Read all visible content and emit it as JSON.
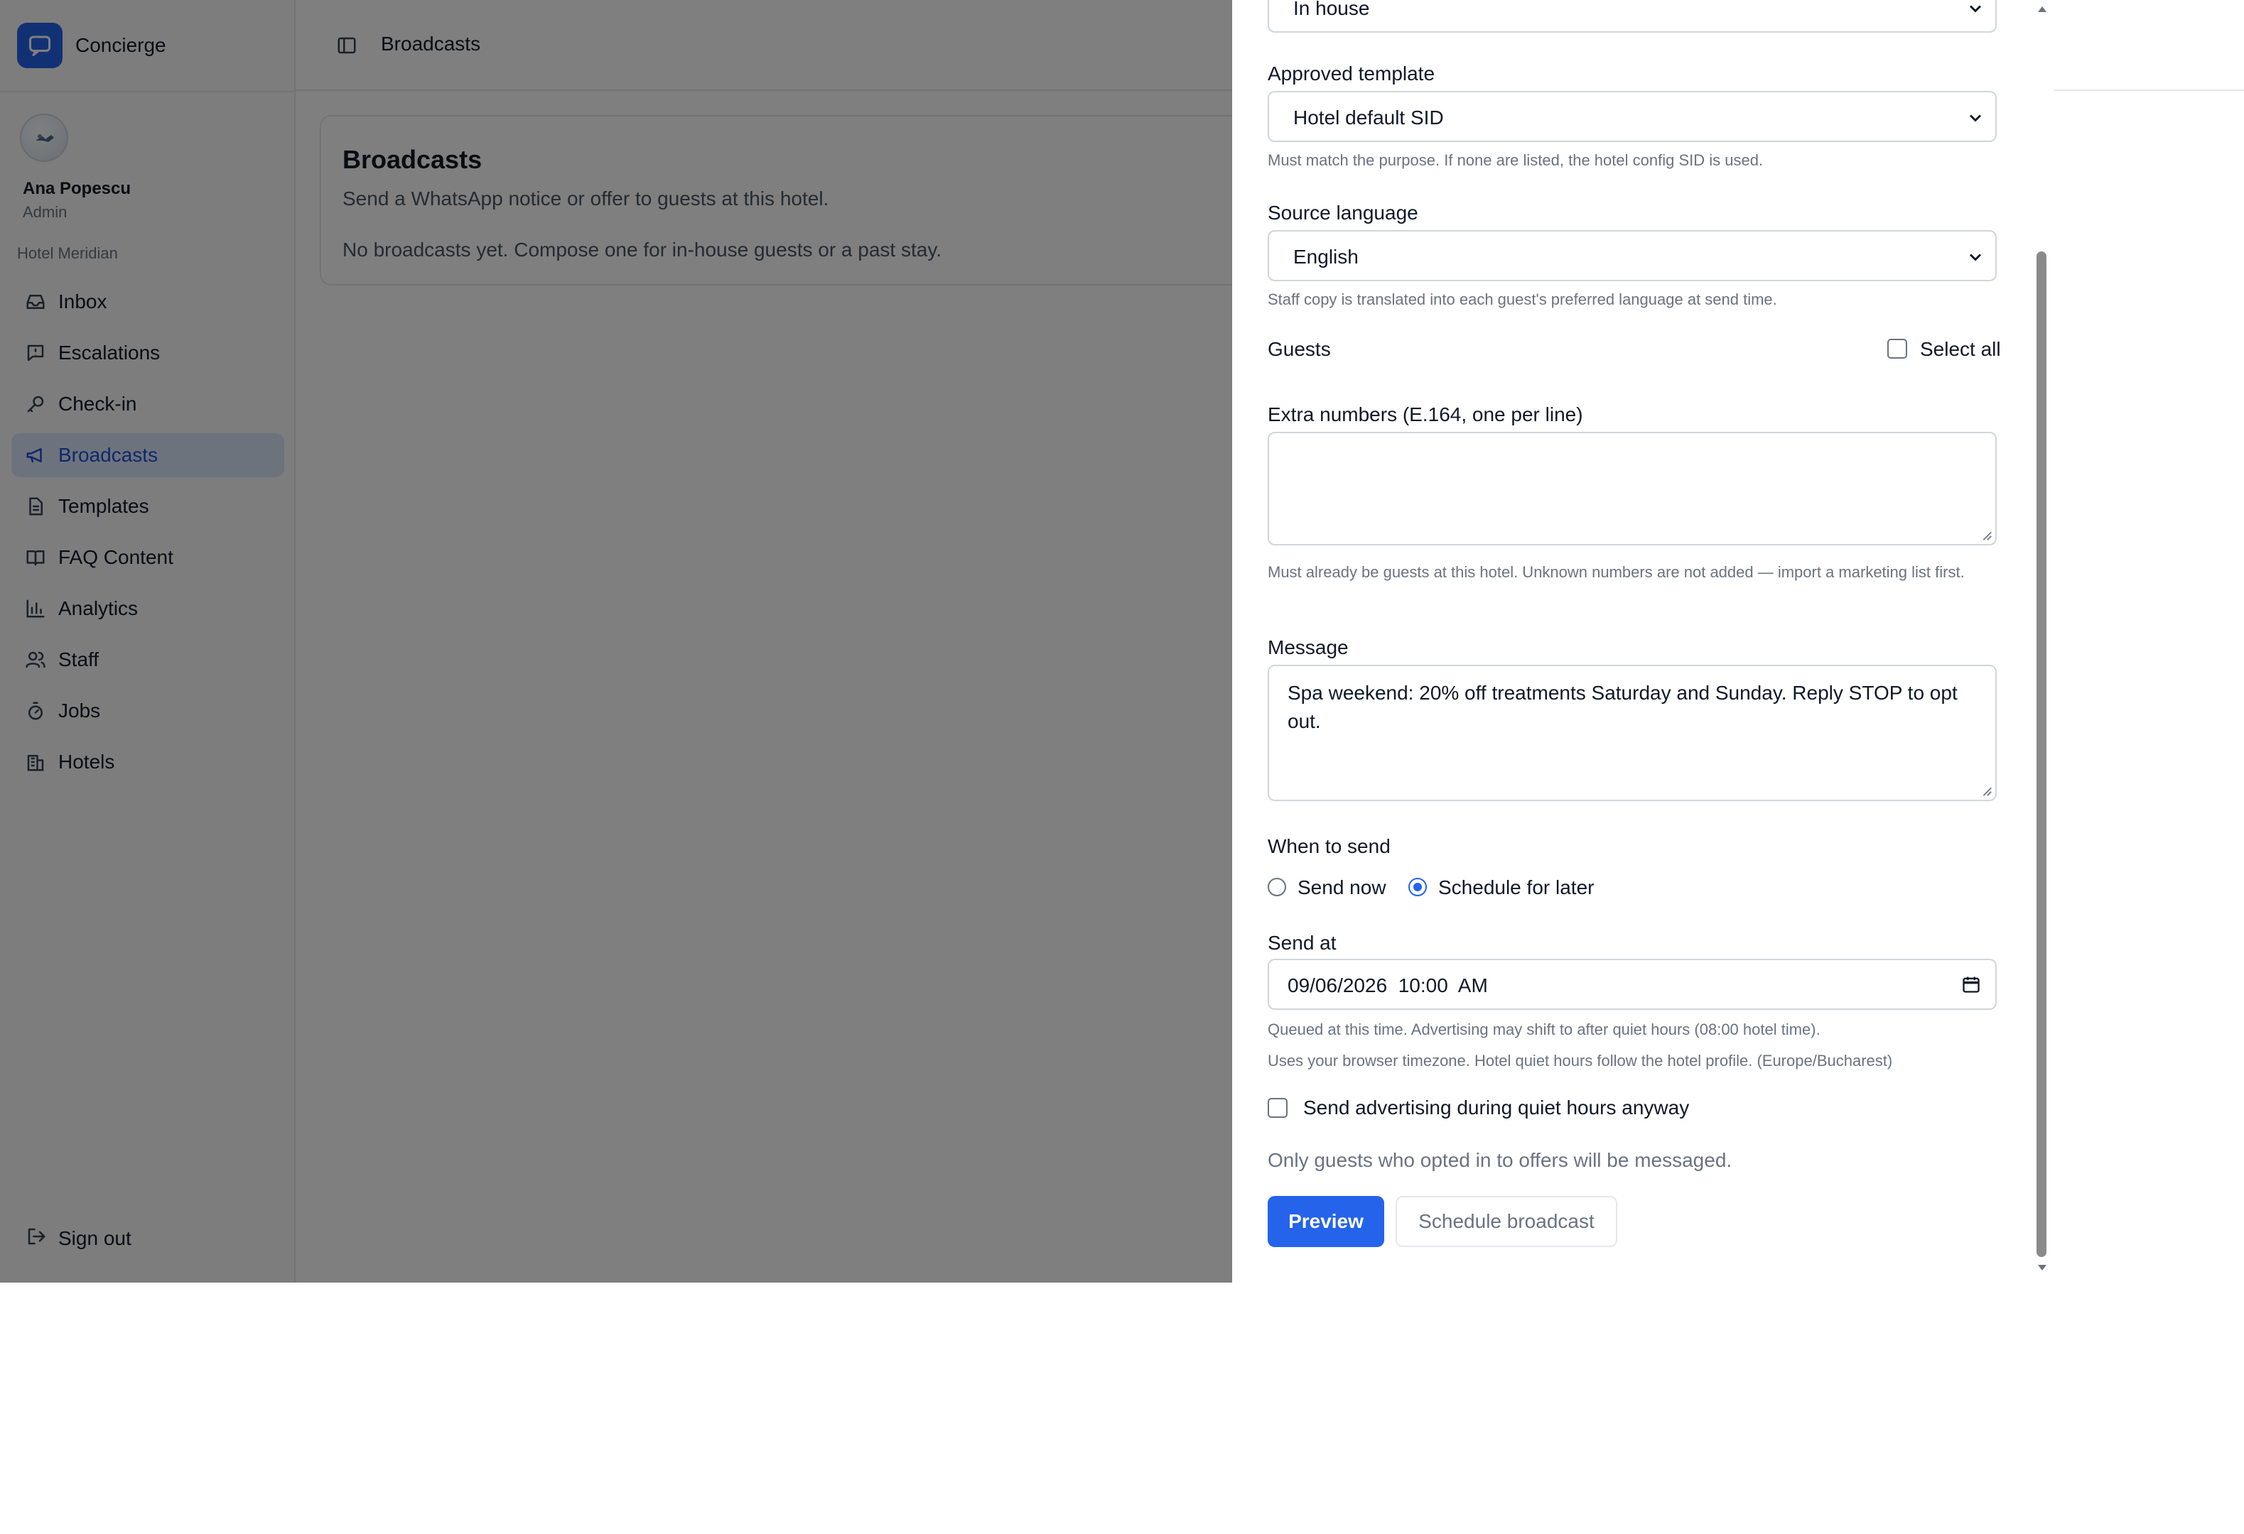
{
  "brand": {
    "name": "Concierge",
    "icon": "chat-bubble-icon",
    "color": "#2563eb"
  },
  "user": {
    "name": "Ana Popescu",
    "role": "Admin",
    "hotel": "Hotel Meridian"
  },
  "sidebar": {
    "items": [
      {
        "label": "Inbox",
        "icon": "inbox-icon"
      },
      {
        "label": "Escalations",
        "icon": "alert-message-icon"
      },
      {
        "label": "Check-in",
        "icon": "key-icon"
      },
      {
        "label": "Broadcasts",
        "icon": "megaphone-icon",
        "active": true
      },
      {
        "label": "Templates",
        "icon": "document-icon"
      },
      {
        "label": "FAQ Content",
        "icon": "book-icon"
      },
      {
        "label": "Analytics",
        "icon": "bar-chart-icon"
      },
      {
        "label": "Staff",
        "icon": "users-icon"
      },
      {
        "label": "Jobs",
        "icon": "timer-icon"
      },
      {
        "label": "Hotels",
        "icon": "building-icon"
      }
    ],
    "signout": "Sign out"
  },
  "header": {
    "title": "Broadcasts"
  },
  "main": {
    "title": "Broadcasts",
    "subtitle": "Send a WhatsApp notice or offer to guests at this hotel.",
    "empty": "No broadcasts yet. Compose one for in-house guests or a past stay."
  },
  "form": {
    "audience_value": "In house",
    "template": {
      "label": "Approved template",
      "value": "Hotel default SID",
      "help": "Must match the purpose. If none are listed, the hotel config SID is used."
    },
    "language": {
      "label": "Source language",
      "value": "English",
      "help": "Staff copy is translated into each guest's preferred language at send time."
    },
    "guests": {
      "label": "Guests",
      "select_all": "Select all",
      "select_all_checked": false
    },
    "extra_numbers": {
      "label": "Extra numbers (E.164, one per line)",
      "value": "",
      "help": "Must already be guests at this hotel. Unknown numbers are not added — import a marketing list first."
    },
    "message": {
      "label": "Message",
      "value": "Spa weekend: 20% off treatments Saturday and Sunday. Reply STOP to opt out."
    },
    "when": {
      "label": "When to send",
      "options": [
        "Send now",
        "Schedule for later"
      ],
      "selected": "Schedule for later"
    },
    "send_at": {
      "label": "Send at",
      "value": "09/06/2026  10:00  AM",
      "help1": "Queued at this time. Advertising may shift to after quiet hours (08:00 hotel time).",
      "help2": "Uses your browser timezone. Hotel quiet hours follow the hotel profile. (Europe/Bucharest)"
    },
    "quiet_hours": {
      "label": "Send advertising during quiet hours anyway",
      "checked": false
    },
    "opt_in_note": "Only guests who opted in to offers will be messaged.",
    "preview_button": "Preview",
    "schedule_button": "Schedule broadcast"
  }
}
